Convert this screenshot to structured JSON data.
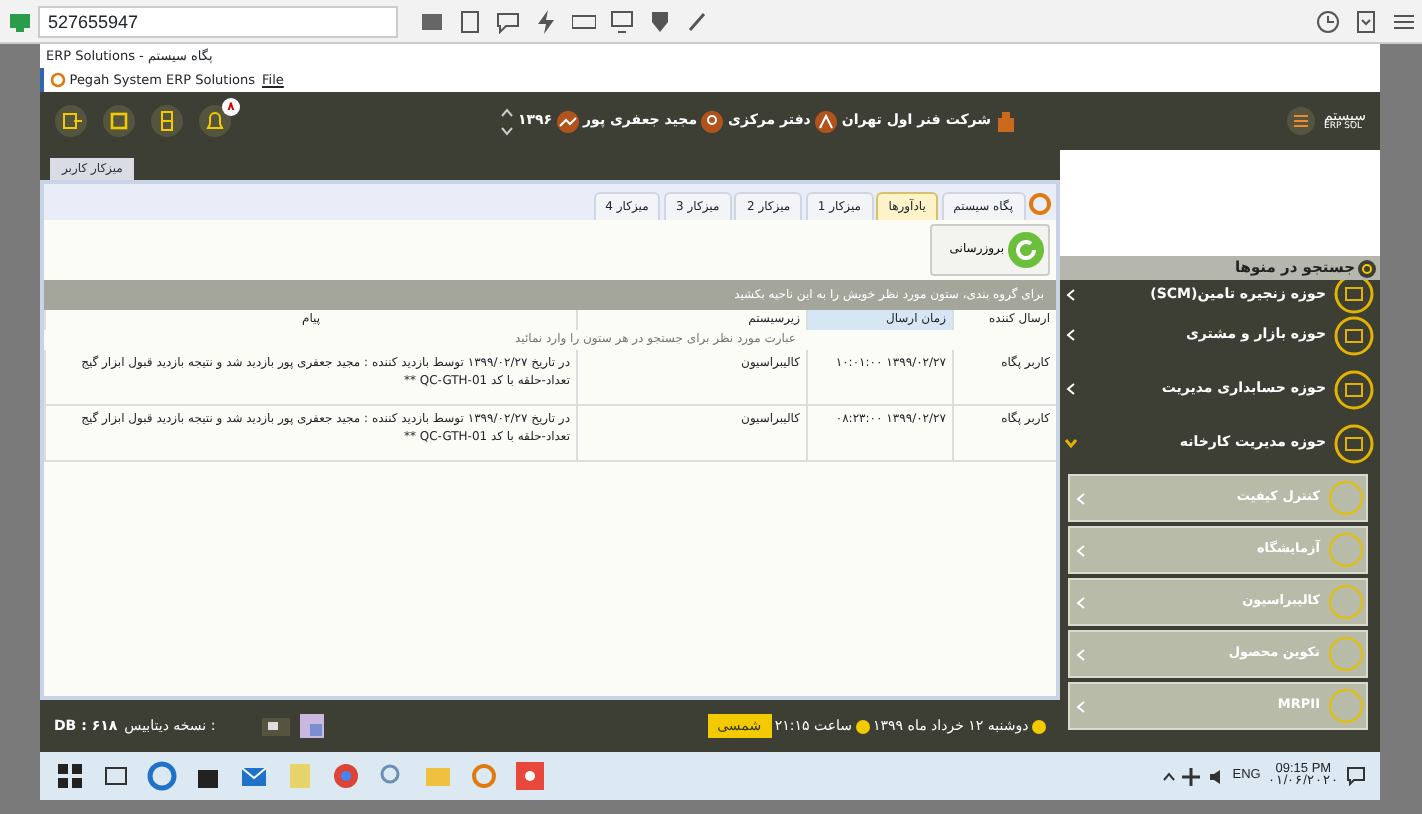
{
  "remote_toolbar": {
    "address": "527655947"
  },
  "window": {
    "title": "ERP Solutions - پگاه سیستم",
    "app_name": "Pegah System ERP Solutions",
    "menu": [
      "File"
    ]
  },
  "header": {
    "notifications": "۸",
    "company": "شرکت فنر اول تهران",
    "branch": "دفتر مرکزی",
    "user": "مجید جعفری پور",
    "year": "۱۳۹۶",
    "logo_text": "سیستم",
    "logo_subtext": "ERP SOL"
  },
  "workspace_tab": "میزکار کاربر",
  "tabs": [
    {
      "label": "پگاه سیستم",
      "selected": false
    },
    {
      "label": "یادآورها",
      "selected": true
    },
    {
      "label": "میزکار 1",
      "selected": false
    },
    {
      "label": "میزکار 2",
      "selected": false
    },
    {
      "label": "میزکار 3",
      "selected": false
    },
    {
      "label": "میزکار 4",
      "selected": false
    }
  ],
  "refresh_button": "بروزرسانی",
  "group_hint": "برای گروه بندی، ستون مورد نظر خویش را به این ناحیه بکشید",
  "table": {
    "columns": [
      {
        "label": "ارسال کننده",
        "highlighted": false
      },
      {
        "label": "زمان ارسال",
        "highlighted": true
      },
      {
        "label": "زیرسیستم",
        "highlighted": false
      },
      {
        "label": "پیام",
        "highlighted": false
      }
    ],
    "filter_placeholder": "عبارت مورد نظر برای جستجو در هر ستون را وارد نمائید",
    "rows": [
      [
        "کاربر پگاه",
        "۱۳۹۹/۰۲/۲۷ ۱۰:۰۱:۰۰",
        "کالیبراسیون",
        "در تاریخ ۱۳۹۹/۰۲/۲۷ توسط بازدید کننده : مجید جعفری پور بازدید شد و نتیجه بازدید قبول ابزار گیج تعداد-حلقه با کد QC-GTH-01 **"
      ],
      [
        "کاربر پگاه",
        "۱۳۹۹/۰۲/۲۷ ۰۸:۲۳:۰۰",
        "کالیبراسیون",
        "در تاریخ ۱۳۹۹/۰۲/۲۷ توسط بازدید کننده : مجید جعفری پور بازدید شد و نتیجه بازدید قبول ابزار گیج تعداد-حلقه با کد QC-GTH-01 **"
      ]
    ]
  },
  "sidebar": {
    "search": "جستجو در منوها",
    "items": [
      {
        "label": "حوزه زنجیره تامین(SCM)",
        "expanded": false
      },
      {
        "label": "حوزه بازار و مشتری",
        "expanded": false
      },
      {
        "label": "حوزه حسابداری مدیریت",
        "expanded": false
      },
      {
        "label": "حوزه مدیریت کارخانه",
        "expanded": true,
        "children": [
          {
            "label": "کنترل کیفیت"
          },
          {
            "label": "آزمایشگاه"
          },
          {
            "label": "کالیبراسیون"
          },
          {
            "label": "تکوین محصول"
          },
          {
            "label": "MRPII"
          }
        ]
      }
    ]
  },
  "status_bar": {
    "date": "دوشنبه ۱۲ خرداد ماه ۱۳۹۹",
    "time": "ساعت ۲۱:۱۵",
    "calendar": "شمسی",
    "db_label": "نسخه دیتابیس :",
    "db_version": "DB : ۶۱۸"
  },
  "taskbar": {
    "language": "ENG",
    "time": "09:15 PM",
    "date": "۰۱/۰۶/۲۰۲۰"
  }
}
